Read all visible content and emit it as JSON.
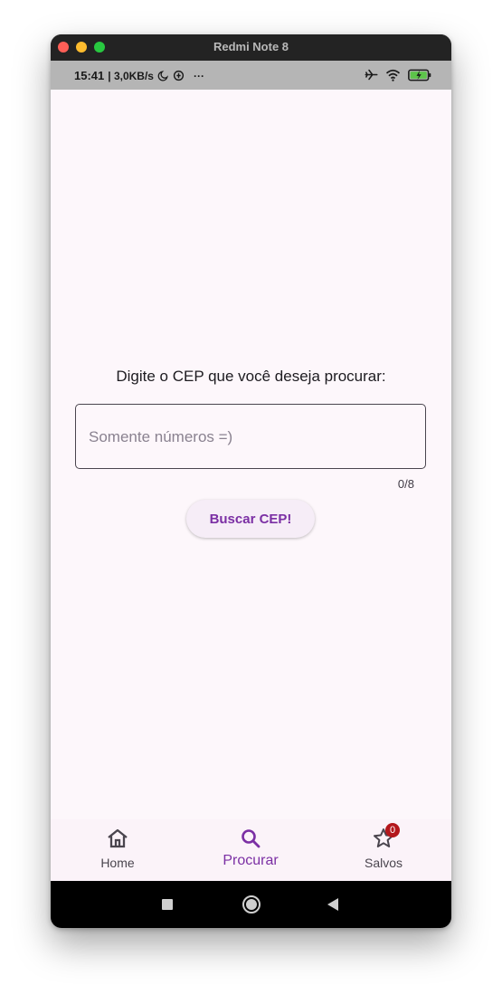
{
  "window": {
    "title": "Redmi Note 8"
  },
  "statusbar": {
    "time": "15:41",
    "speed": "| 3,0KB/s",
    "more": "···",
    "icons": [
      "moon-icon",
      "data-saver-icon",
      "airplane-icon",
      "wifi-icon",
      "battery-charging-icon"
    ]
  },
  "main": {
    "prompt": "Digite o CEP que você deseja procurar:",
    "input_value": "",
    "input_placeholder": "Somente números =)",
    "counter": "0/8",
    "button_label": "Buscar CEP!"
  },
  "bottom_nav": {
    "items": [
      {
        "label": "Home",
        "icon": "home-icon"
      },
      {
        "label": "Procurar",
        "icon": "search-icon",
        "active": true
      },
      {
        "label": "Salvos",
        "icon": "star-icon",
        "badge": "0"
      }
    ]
  },
  "colors": {
    "accent": "#7b2fa4",
    "background": "#fdf7fb",
    "badge": "#b3171c",
    "statusbar": "#b5b5b5"
  }
}
